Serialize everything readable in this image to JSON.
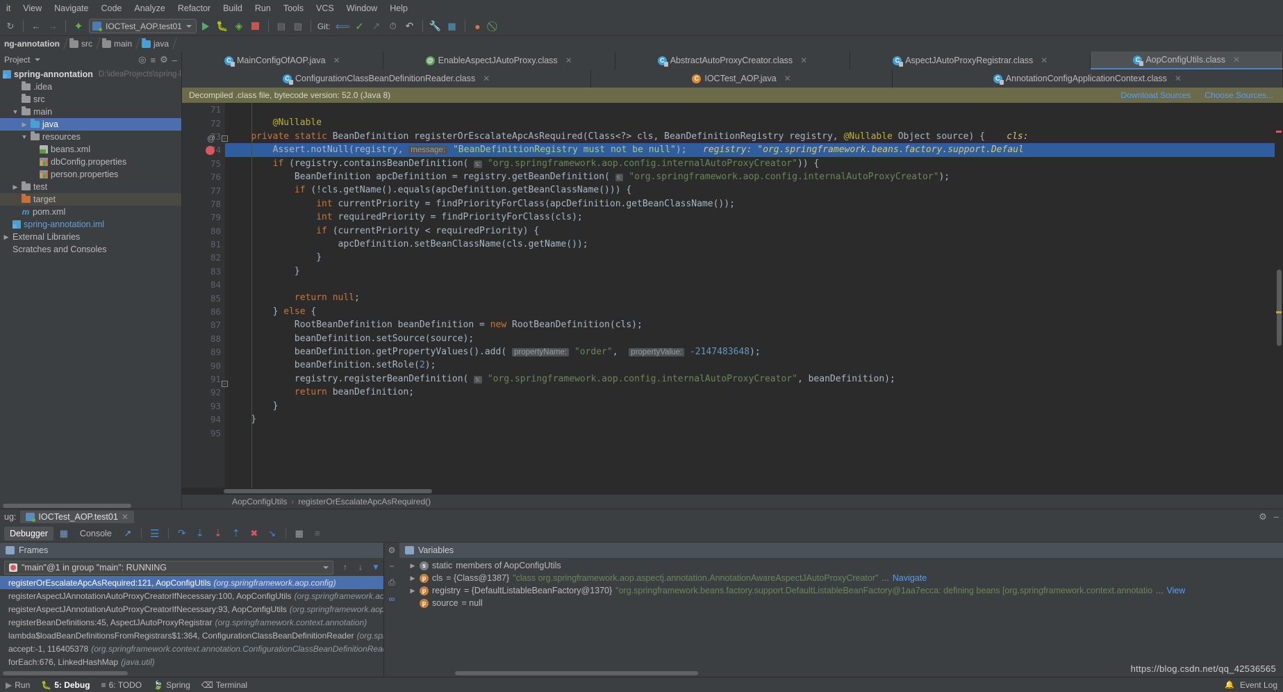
{
  "menubar": {
    "items": [
      "it",
      "View",
      "Navigate",
      "Code",
      "Analyze",
      "Refactor",
      "Build",
      "Run",
      "Tools",
      "VCS",
      "Window",
      "Help"
    ]
  },
  "toolbar": {
    "run_config": "IOCTest_AOP.test01",
    "git_label": "Git:"
  },
  "navbar": {
    "crumbs": [
      "ng-annotation",
      "src",
      "main",
      "java"
    ]
  },
  "sidebar": {
    "title": "Project",
    "project_name": "spring-annontation",
    "project_path": "D:\\ideaProjects\\spring-learnin",
    "tree": [
      {
        "label": ".idea",
        "indent": 1,
        "arrow": "",
        "icon": "folder",
        "state": ""
      },
      {
        "label": "src",
        "indent": 1,
        "arrow": "",
        "icon": "folder",
        "state": ""
      },
      {
        "label": "main",
        "indent": 1,
        "arrow": "▼",
        "icon": "folder",
        "state": ""
      },
      {
        "label": "java",
        "indent": 2,
        "arrow": "▶",
        "icon": "folder-blue",
        "state": "selected"
      },
      {
        "label": "resources",
        "indent": 2,
        "arrow": "▼",
        "icon": "folder-res",
        "state": ""
      },
      {
        "label": "beans.xml",
        "indent": 3,
        "arrow": "",
        "icon": "xml",
        "state": ""
      },
      {
        "label": "dbConfig.properties",
        "indent": 3,
        "arrow": "",
        "icon": "prop",
        "state": ""
      },
      {
        "label": "person.properties",
        "indent": 3,
        "arrow": "",
        "icon": "prop",
        "state": ""
      },
      {
        "label": "test",
        "indent": 1,
        "arrow": "▶",
        "icon": "folder",
        "state": ""
      },
      {
        "label": "target",
        "indent": 1,
        "arrow": "",
        "icon": "folder-orange",
        "state": "dim"
      },
      {
        "label": "pom.xml",
        "indent": 1,
        "arrow": "",
        "icon": "maven",
        "state": ""
      },
      {
        "label": "spring-annotation.iml",
        "indent": 0,
        "arrow": "",
        "icon": "module",
        "state": ""
      },
      {
        "label": "External Libraries",
        "indent": 0,
        "arrow": "▶",
        "icon": "none",
        "state": ""
      },
      {
        "label": "Scratches and Consoles",
        "indent": 0,
        "arrow": "",
        "icon": "none",
        "state": ""
      }
    ]
  },
  "editor": {
    "tabs_row1": [
      {
        "label": "MainConfigOfAOP.java",
        "icon": "class",
        "active": false,
        "closable": true
      },
      {
        "label": "EnableAspectJAutoProxy.class",
        "icon": "annotation",
        "active": false,
        "closable": true
      },
      {
        "label": "AbstractAutoProxyCreator.class",
        "icon": "classlib",
        "active": false,
        "closable": true
      },
      {
        "label": "AspectJAutoProxyRegistrar.class",
        "icon": "classlib",
        "active": false,
        "closable": true
      },
      {
        "label": "AopConfigUtils.class",
        "icon": "classlib",
        "active": true,
        "closable": true
      }
    ],
    "tabs_row2": [
      {
        "label": "ConfigurationClassBeanDefinitionReader.class",
        "icon": "classlib",
        "active": false,
        "closable": true
      },
      {
        "label": "IOCTest_AOP.java",
        "icon": "test",
        "active": false,
        "closable": true
      },
      {
        "label": "AnnotationConfigApplicationContext.class",
        "icon": "classlib",
        "active": false,
        "closable": true
      }
    ],
    "banner": {
      "text": "Decompiled .class file, bytecode version: 52.0 (Java 8)",
      "download_sources": "Download Sources",
      "choose_sources": "Choose Sources..."
    },
    "line_numbers": [
      "71",
      "72",
      "73",
      "74",
      "75",
      "76",
      "77",
      "78",
      "79",
      "80",
      "81",
      "82",
      "83",
      "84",
      "85",
      "86",
      "87",
      "88",
      "89",
      "90",
      "91",
      "92",
      "93",
      "94",
      "95"
    ],
    "breadcrumb_class": "AopConfigUtils",
    "breadcrumb_method": "registerOrEscalateApcAsRequired()"
  },
  "code_lines": [
    {
      "n": "71",
      "html": ""
    },
    {
      "n": "72",
      "html": "        <span class='ann2'>@Nullable</span>"
    },
    {
      "n": "73",
      "html": "    <span class='kw'>private static</span> BeanDefinition registerOrEscalateApcAsRequired(Class&lt;?&gt; cls, BeanDefinitionRegistry registry, <span class='ann2'>@Nullable</span> Object source) {    <span class='param-ital'>cls:</span>"
    },
    {
      "n": "74",
      "html": "        Assert.notNull(registry, <span class='hint'>message:</span> <span class='str-hl'>\"BeanDefinitionRegistry must not be null\"</span>);   <span class='param-ital'>registry:</span> <span class='param-ital'>\"org.springframework.beans.factory.support.Defaul</span>",
      "highlight": true
    },
    {
      "n": "75",
      "html": "        <span class='kw'>if</span> (registry.containsBeanDefinition( <span class='hint-s'>s:</span> <span class='str'>\"org.springframework.aop.config.internalAutoProxyCreator\"</span>)) {"
    },
    {
      "n": "76",
      "html": "            BeanDefinition apcDefinition = registry.getBeanDefinition( <span class='hint-s'>s:</span> <span class='str'>\"org.springframework.aop.config.internalAutoProxyCreator\"</span>);"
    },
    {
      "n": "77",
      "html": "            <span class='kw'>if</span> (!cls.getName().equals(apcDefinition.getBeanClassName())) {"
    },
    {
      "n": "78",
      "html": "                <span class='kw'>int</span> currentPriority = findPriorityForClass(apcDefinition.getBeanClassName());"
    },
    {
      "n": "79",
      "html": "                <span class='kw'>int</span> requiredPriority = findPriorityForClass(cls);"
    },
    {
      "n": "80",
      "html": "                <span class='kw'>if</span> (currentPriority &lt; requiredPriority) {"
    },
    {
      "n": "81",
      "html": "                    apcDefinition.setBeanClassName(cls.getName());"
    },
    {
      "n": "82",
      "html": "                }"
    },
    {
      "n": "83",
      "html": "            }"
    },
    {
      "n": "84",
      "html": ""
    },
    {
      "n": "85",
      "html": "            <span class='kw'>return null</span>;"
    },
    {
      "n": "86",
      "html": "        } <span class='kw'>else</span> {"
    },
    {
      "n": "87",
      "html": "            RootBeanDefinition beanDefinition = <span class='kw'>new</span> RootBeanDefinition(cls);"
    },
    {
      "n": "88",
      "html": "            beanDefinition.setSource(source);"
    },
    {
      "n": "89",
      "html": "            beanDefinition.getPropertyValues().add( <span class='hint'>propertyName:</span> <span class='str'>\"order\"</span>,  <span class='hint'>propertyValue:</span> <span class='num'>-2147483648</span>);"
    },
    {
      "n": "90",
      "html": "            beanDefinition.setRole(<span class='num'>2</span>);"
    },
    {
      "n": "91",
      "html": "            registry.registerBeanDefinition( <span class='hint-s'>s:</span> <span class='str'>\"org.springframework.aop.config.internalAutoProxyCreator\"</span>, beanDefinition);"
    },
    {
      "n": "92",
      "html": "            <span class='kw'>return</span> beanDefinition;"
    },
    {
      "n": "93",
      "html": "        }"
    },
    {
      "n": "94",
      "html": "    }"
    },
    {
      "n": "95",
      "html": ""
    }
  ],
  "debug": {
    "label": "ug:",
    "session_tab": "IOCTest_AOP.test01",
    "tabs": [
      "Debugger",
      "Console"
    ],
    "active_tab": "Debugger",
    "frames_title": "Frames",
    "thread": "\"main\"@1 in group \"main\": RUNNING",
    "frames": [
      {
        "method": "registerOrEscalateApcAsRequired:121, AopConfigUtils",
        "pkg": "(org.springframework.aop.config)",
        "selected": true
      },
      {
        "method": "registerAspectJAnnotationAutoProxyCreatorIfNecessary:100, AopConfigUtils",
        "pkg": "(org.springframework.aop.config",
        "selected": false
      },
      {
        "method": "registerAspectJAnnotationAutoProxyCreatorIfNecessary:93, AopConfigUtils",
        "pkg": "(org.springframework.aop.config)",
        "selected": false
      },
      {
        "method": "registerBeanDefinitions:45, AspectJAutoProxyRegistrar",
        "pkg": "(org.springframework.context.annotation)",
        "selected": false
      },
      {
        "method": "lambda$loadBeanDefinitionsFromRegistrars$1:364, ConfigurationClassBeanDefinitionReader",
        "pkg": "(org.springframe",
        "selected": false
      },
      {
        "method": "accept:-1, 116405378",
        "pkg": "(org.springframework.context.annotation.ConfigurationClassBeanDefinitionReader$$Lam",
        "selected": false
      },
      {
        "method": "forEach:676, LinkedHashMap",
        "pkg": "(java.util)",
        "selected": false
      }
    ],
    "variables_title": "Variables",
    "variables": [
      {
        "expander": "▶",
        "badge": "s",
        "name": "static",
        "rest": " members of AopConfigUtils",
        "kind": "static"
      },
      {
        "expander": "▶",
        "badge": "p",
        "name": "cls",
        "rest": " = {Class@1387} ",
        "str": "\"class org.springframework.aop.aspectj.annotation.AnnotationAwareAspectJAutoProxyCreator\"",
        "suffix": "... ",
        "link": "Navigate",
        "kind": "obj"
      },
      {
        "expander": "▶",
        "badge": "p",
        "name": "registry",
        "rest": " = {DefaultListableBeanFactory@1370} ",
        "str": "\"org.springframework.beans.factory.support.DefaultListableBeanFactory@1aa7ecca: defining beans [org.springframework.context.annotatio",
        "suffix": "... ",
        "link": "View",
        "kind": "obj"
      },
      {
        "expander": "",
        "badge": "p",
        "name": "source",
        "rest": " = null",
        "kind": "obj"
      }
    ]
  },
  "statusbar": {
    "items": [
      "Run",
      "5: Debug",
      "6: TODO",
      "Spring",
      "Terminal"
    ],
    "event_log": "Event Log"
  },
  "watermark": "https://blog.csdn.net/qq_42536565",
  "colors": {
    "accent_blue": "#4b6eaf",
    "selection_blue": "#2f5d9e",
    "banner_olive": "#6b6b4a",
    "link": "#589df6",
    "string_green": "#6a8759",
    "keyword_orange": "#cc7832",
    "number_blue": "#6897bb",
    "annotation_yellow": "#bbb529"
  }
}
